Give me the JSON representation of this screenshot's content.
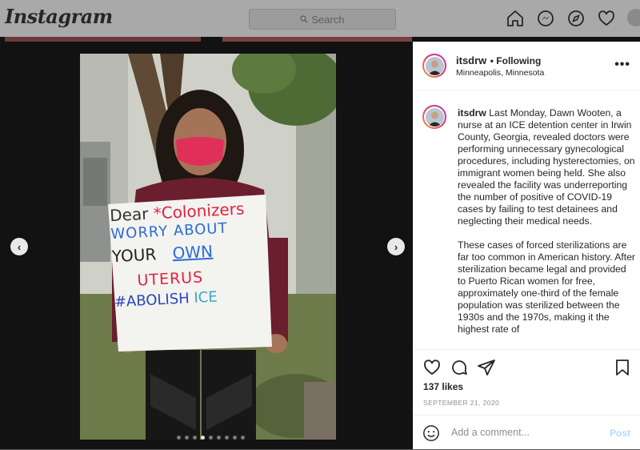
{
  "app": {
    "logo": "Instagram"
  },
  "search": {
    "placeholder": "Search"
  },
  "nav": {
    "icons": [
      "home-icon",
      "messenger-icon",
      "explore-icon",
      "heart-icon",
      "profile-avatar"
    ]
  },
  "post": {
    "username": "itsdrw",
    "follow_status": "• Following",
    "location": "Minneapolis, Minnesota",
    "caption_paragraphs": [
      "Last Monday, Dawn Wooten, a nurse at an ICE detention center in Irwin County, Georgia, revealed doctors were performing unnecessary gynecological procedures, including hysterectomies, on immigrant women being held. She also revealed the facility was underreporting the number of positive of COVID-19 cases by failing to test detainees and neglecting their medical needs.",
      "These cases of forced sterilizations are far too common in American history. After sterilization became legal and provided to Puerto Rican women for free, approximately one-third of the female population was sterilized between the 1930s and the 1970s, making it the highest rate of"
    ],
    "likes": "137 likes",
    "date": "SEPTEMBER 21, 2020",
    "comment_placeholder": "Add a comment...",
    "post_label": "Post",
    "carousel": {
      "count": 9,
      "active": 3
    },
    "sign_text": {
      "line1a": "Dear",
      "line1b": "*Colonizers",
      "line2": "WORRY ABOUT",
      "line3a": "YOUR",
      "line3b": "OWN",
      "line4": "UTERUS",
      "line5a": "#ABOLISH",
      "line5b": "ICE"
    }
  },
  "colors": {
    "accent": "#0095f6",
    "post_disabled": "#b3dbff"
  }
}
